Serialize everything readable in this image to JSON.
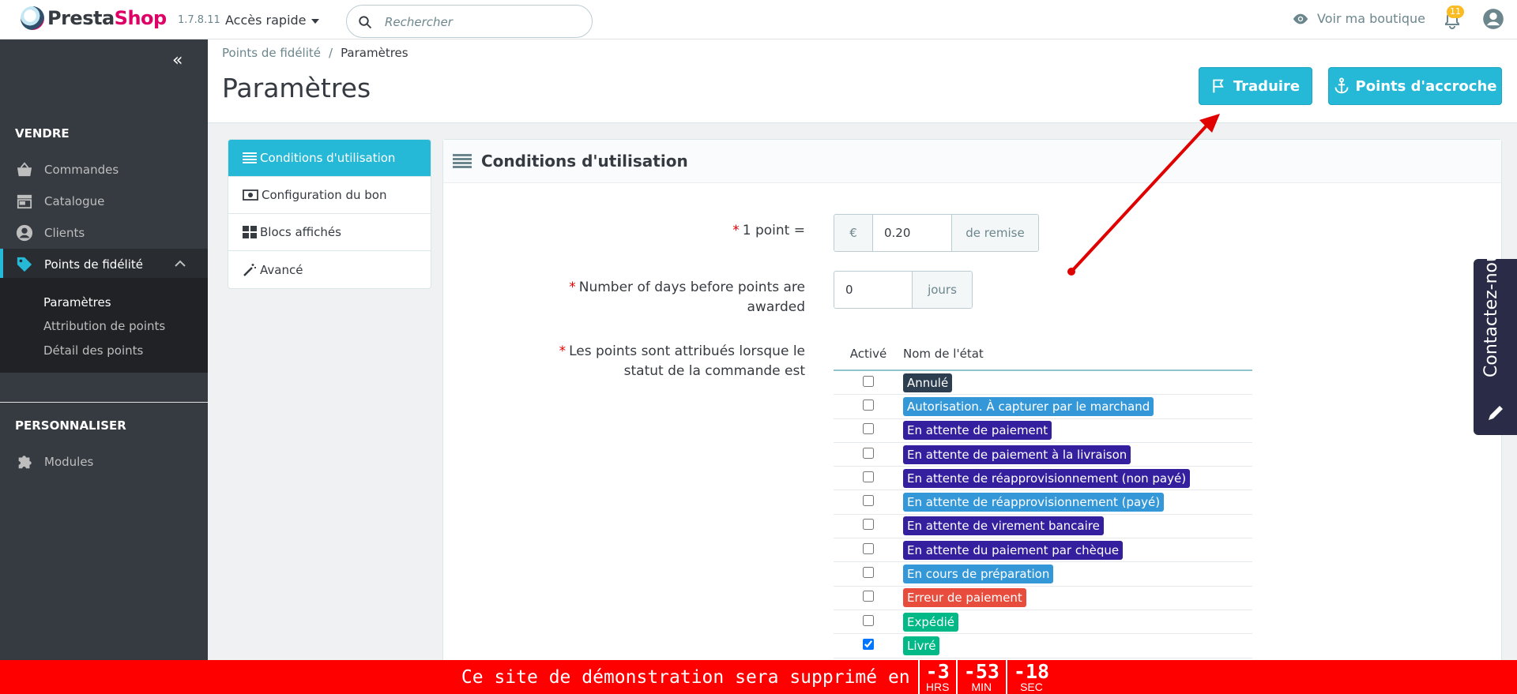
{
  "header": {
    "logo_text_1": "Presta",
    "logo_text_2": "Shop",
    "version": "1.7.8.11",
    "quick_access": "Accès rapide",
    "search_placeholder": "Rechercher",
    "view_shop": "Voir ma boutique",
    "notifications_count": "11"
  },
  "sidebar": {
    "collapse_glyph": "«",
    "section_sell": "VENDRE",
    "items": [
      {
        "label": "Commandes",
        "icon": "basket-icon"
      },
      {
        "label": "Catalogue",
        "icon": "store-icon"
      },
      {
        "label": "Clients",
        "icon": "account-icon"
      },
      {
        "label": "Points de fidélité",
        "icon": "tag-icon"
      }
    ],
    "subitems": [
      "Paramètres",
      "Attribution de points",
      "Détail des points"
    ],
    "section_custom": "PERSONNALISER",
    "modules": "Modules"
  },
  "breadcrumb": {
    "parent": "Points de fidélité",
    "separator": "/",
    "current": "Paramètres"
  },
  "page_title": "Paramètres",
  "toolbar": {
    "translate": "Traduire",
    "hooks": "Points d'accroche"
  },
  "leftnav": [
    "Conditions d'utilisation",
    "Configuration du bon",
    "Blocs affichés",
    "Avancé"
  ],
  "panel": {
    "title": "Conditions d'utilisation",
    "point_label": "1 point =",
    "point_prefix": "€",
    "point_value": "0.20",
    "point_suffix": "de remise",
    "days_label_1": "Number of days before points are",
    "days_label_2": "awarded",
    "days_value": "0",
    "days_suffix": "jours",
    "status_label_1": "Les points sont attribués lorsque le",
    "status_label_2": "statut de la commande est",
    "col_active": "Activé",
    "col_name": "Nom de l'état",
    "states": [
      {
        "name": "Annulé",
        "color": "#2c3e50",
        "checked": false
      },
      {
        "name": "Autorisation. À capturer par le marchand",
        "color": "#3498d8",
        "checked": false
      },
      {
        "name": "En attente de paiement",
        "color": "#34209e",
        "checked": false
      },
      {
        "name": "En attente de paiement à la livraison",
        "color": "#34209e",
        "checked": false
      },
      {
        "name": "En attente de réapprovisionnement (non payé)",
        "color": "#34209e",
        "checked": false
      },
      {
        "name": "En attente de réapprovisionnement (payé)",
        "color": "#3498d8",
        "checked": false
      },
      {
        "name": "En attente de virement bancaire",
        "color": "#34209e",
        "checked": false
      },
      {
        "name": "En attente du paiement par chèque",
        "color": "#34209e",
        "checked": false
      },
      {
        "name": "En cours de préparation",
        "color": "#3498d8",
        "checked": false
      },
      {
        "name": "Erreur de paiement",
        "color": "#e74c3c",
        "checked": false
      },
      {
        "name": "Expédié",
        "color": "#01b887",
        "checked": false
      },
      {
        "name": "Livré",
        "color": "#01b887",
        "checked": true
      }
    ]
  },
  "contact_tab": "Contactez-nous",
  "banner": {
    "message": "Ce site de démonstration sera supprimé en",
    "hours": "-3",
    "hours_unit": "HRS",
    "minutes": "-53",
    "minutes_unit": "MIN",
    "seconds": "-18",
    "seconds_unit": "SEC"
  },
  "colors": {
    "accent": "#25b9d7",
    "sidebar": "#363a41",
    "banner": "#ff0000",
    "required": "#e50000"
  }
}
